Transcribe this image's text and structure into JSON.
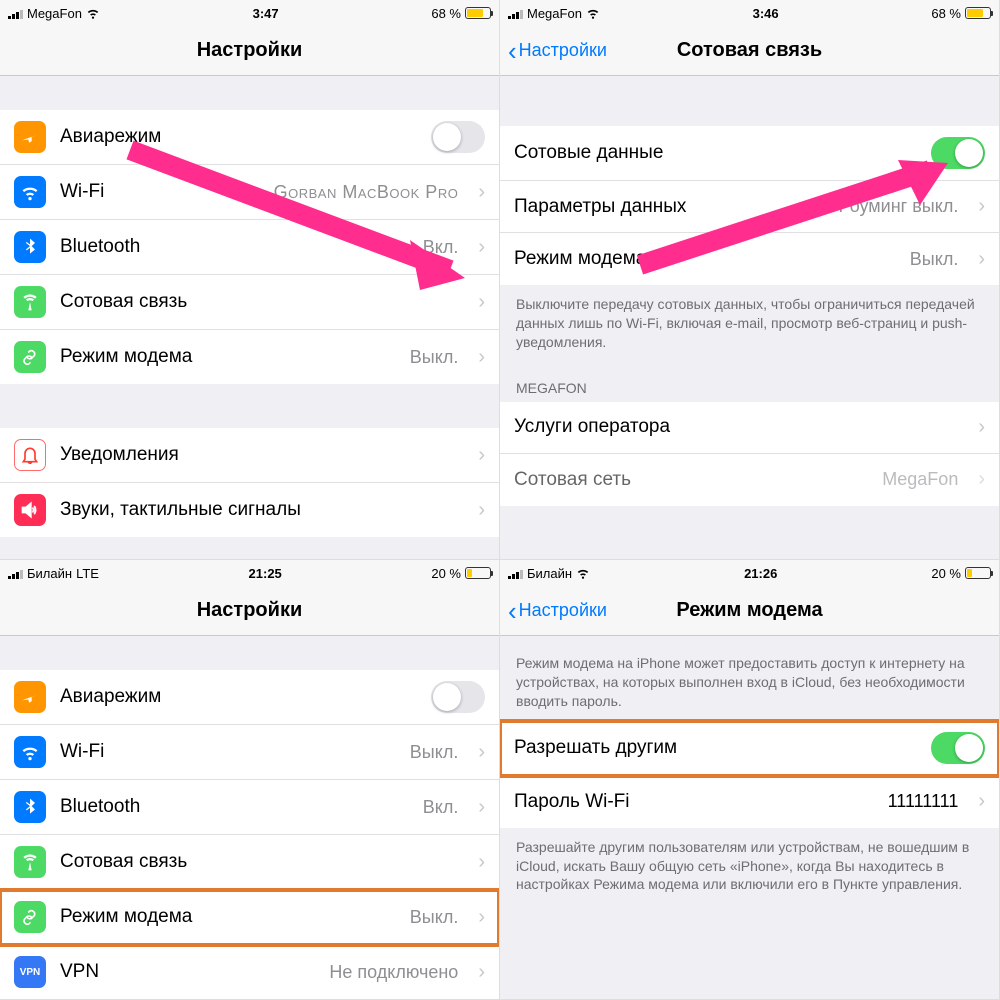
{
  "colors": {
    "accent_blue": "#007aff",
    "toggle_green": "#4cd964",
    "arrow_pink": "#ff2d8e",
    "highlight_orange": "#e07a2f",
    "icon_orange": "#ff9500",
    "icon_blue": "#007aff",
    "icon_green": "#4cd964",
    "icon_red": "#ff3b30",
    "icon_teal": "#34aadc"
  },
  "p1": {
    "status": {
      "carrier": "MegaFon",
      "net_icon": "wifi",
      "time": "3:47",
      "battery_pct": "68 %",
      "battery_fill": 68
    },
    "title": "Настройки",
    "rows": {
      "airplane": {
        "label": "Авиарежим"
      },
      "wifi": {
        "label": "Wi-Fi",
        "value": "Gorban MacBook Pro"
      },
      "bluetooth": {
        "label": "Bluetooth",
        "value": "Вкл."
      },
      "cellular": {
        "label": "Сотовая связь"
      },
      "hotspot": {
        "label": "Режим модема",
        "value": "Выкл."
      },
      "notifications": {
        "label": "Уведомления"
      },
      "sounds": {
        "label": "Звуки, тактильные сигналы"
      }
    }
  },
  "p2": {
    "status": {
      "carrier": "MegaFon",
      "net_icon": "wifi",
      "time": "3:46",
      "battery_pct": "68 %",
      "battery_fill": 68
    },
    "back": "Настройки",
    "title": "Сотовая связь",
    "rows": {
      "cell_data": {
        "label": "Сотовые данные"
      },
      "data_opts": {
        "label": "Параметры данных",
        "value": "Роуминг выкл."
      },
      "hotspot": {
        "label": "Режим модема",
        "value": "Выкл."
      },
      "services": {
        "label": "Услуги оператора"
      },
      "network": {
        "label": "Сотовая сеть",
        "value": "MegaFon"
      }
    },
    "footer": "Выключите передачу сотовых данных, чтобы ограничиться передачей данных лишь по Wi-Fi, включая e-mail, просмотр веб-страниц и push-уведомления.",
    "section": "MEGAFON"
  },
  "p3": {
    "status": {
      "carrier": "Билайн",
      "net_label": "LTE",
      "time": "21:25",
      "battery_pct": "20 %",
      "battery_fill": 20
    },
    "title": "Настройки",
    "rows": {
      "airplane": {
        "label": "Авиарежим"
      },
      "wifi": {
        "label": "Wi-Fi",
        "value": "Выкл."
      },
      "bluetooth": {
        "label": "Bluetooth",
        "value": "Вкл."
      },
      "cellular": {
        "label": "Сотовая связь"
      },
      "hotspot": {
        "label": "Режим модема",
        "value": "Выкл."
      },
      "vpn": {
        "label": "VPN",
        "value": "Не подключено"
      }
    }
  },
  "p4": {
    "status": {
      "carrier": "Билайн",
      "net_icon": "wifi",
      "time": "21:26",
      "battery_pct": "20 %",
      "battery_fill": 20
    },
    "back": "Настройки",
    "title": "Режим модема",
    "intro": "Режим модема на iPhone может предоставить доступ к интернету на устройствах, на которых выполнен вход в iCloud, без необходимости вводить пароль.",
    "rows": {
      "allow": {
        "label": "Разрешать другим"
      },
      "pwd": {
        "label": "Пароль Wi-Fi",
        "value": "11111111"
      }
    },
    "footer": "Разрешайте другим пользователям или устройствам, не вошедшим в iCloud, искать Вашу общую сеть «iPhone», когда Вы находитесь в настройках Режима модема или включили его в Пункте управления."
  }
}
